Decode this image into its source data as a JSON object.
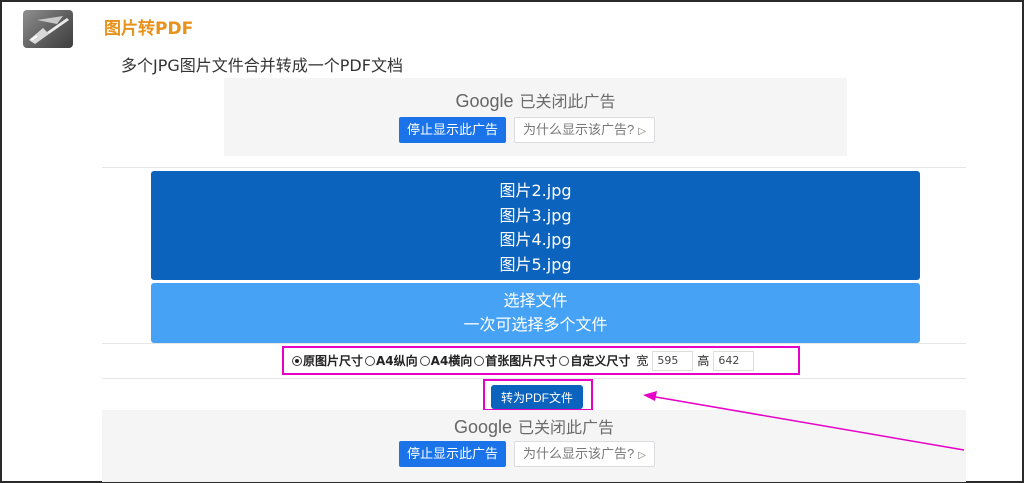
{
  "app": {
    "logo_icon": "pen-on-paper-icon",
    "title": "图片转PDF",
    "subtitle": "多个JPG图片文件合并转成一个PDF文档"
  },
  "ad_top": {
    "brand": "Google",
    "closed_text": "已关闭此广告",
    "stop_label": "停止显示此广告",
    "why_label": "为什么显示该广告?"
  },
  "files": [
    "图片2.jpg",
    "图片3.jpg",
    "图片4.jpg",
    "图片5.jpg"
  ],
  "choose": {
    "label": "选择文件",
    "hint": "一次可选择多个文件"
  },
  "size_options": {
    "items": [
      {
        "label": "原图片尺寸",
        "selected": true
      },
      {
        "label": "A4纵向",
        "selected": false
      },
      {
        "label": "A4横向",
        "selected": false
      },
      {
        "label": "首张图片尺寸",
        "selected": false
      },
      {
        "label": "自定义尺寸",
        "selected": false
      }
    ],
    "width_label": "宽",
    "width_value": "595",
    "height_label": "高",
    "height_value": "642"
  },
  "convert": {
    "label": "转为PDF文件"
  },
  "ad_bottom": {
    "brand": "Google",
    "closed_text": "已关闭此广告",
    "stop_label": "停止显示此广告",
    "why_label": "为什么显示该广告?"
  },
  "colors": {
    "title_orange": "#e8921c",
    "file_list_blue": "#0b63bd",
    "choose_blue": "#45a2f5",
    "highlight_magenta": "#e600c8",
    "ad_blue": "#1a73e8"
  }
}
